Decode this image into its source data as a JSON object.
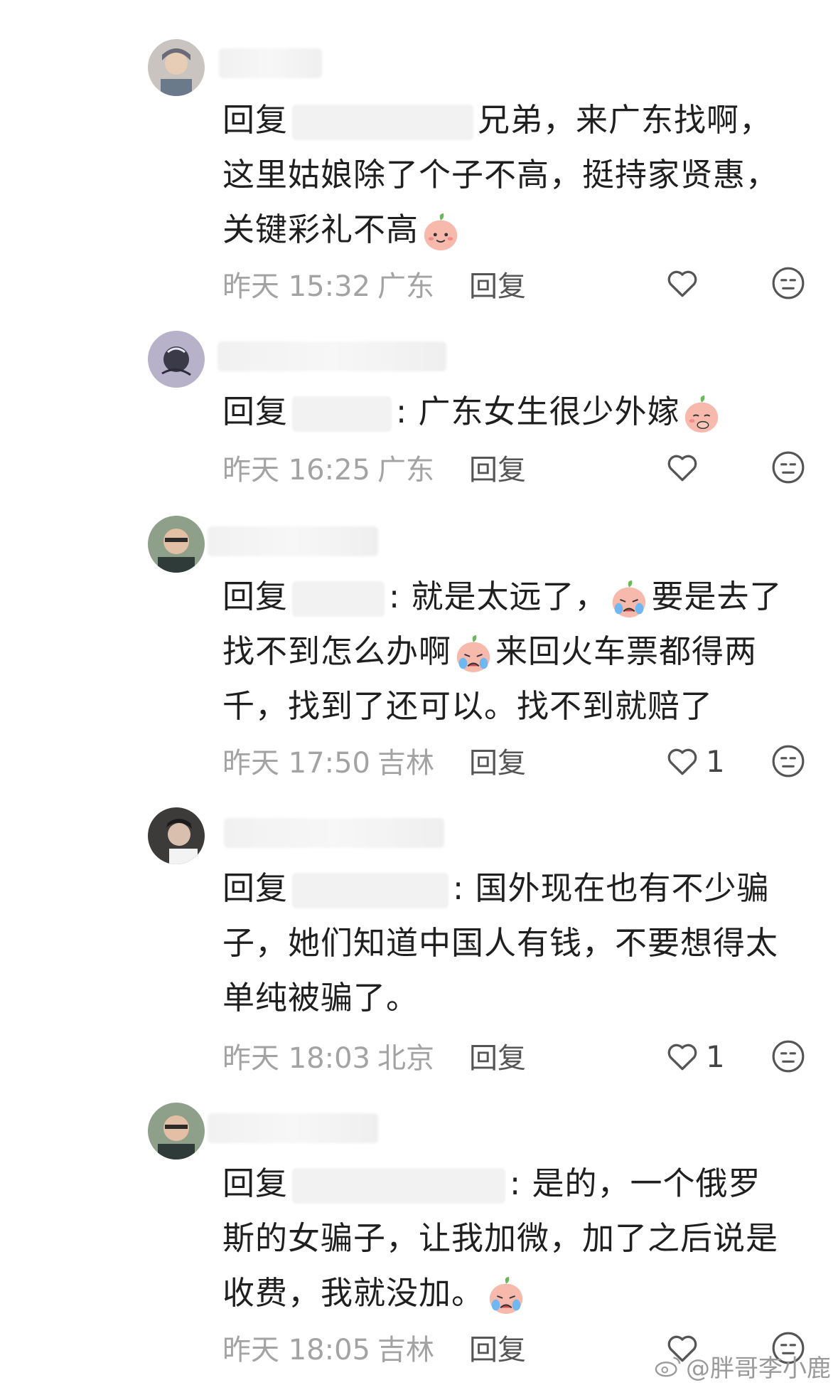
{
  "comments": [
    {
      "reply_prefix": "回复",
      "text_a": "兄弟，来广东找啊，",
      "text_b": "这里姑娘除了个子不高，挺持家贤惠，",
      "text_c": "关键彩礼不高",
      "time": "昨天 15:32",
      "location": "广东",
      "reply_label": "回复",
      "likes": ""
    },
    {
      "reply_prefix": "回复",
      "text_a": ": 广东女生很少外嫁",
      "time": "昨天 16:25",
      "location": "广东",
      "reply_label": "回复",
      "likes": ""
    },
    {
      "reply_prefix": "回复",
      "text_a": ": 就是太远了，",
      "text_b": "要是去了",
      "text_c": "找不到怎么办啊",
      "text_d": "来回火车票都得两",
      "text_e": "千，找到了还可以。找不到就赔了",
      "time": "昨天 17:50",
      "location": "吉林",
      "reply_label": "回复",
      "likes": "1"
    },
    {
      "reply_prefix": "回复",
      "text_a": ": 国外现在也有不少骗",
      "text_b": "子，她们知道中国人有钱，不要想得太",
      "text_c": "单纯被骗了。",
      "time": "昨天 18:03",
      "location": "北京",
      "reply_label": "回复",
      "likes": "1"
    },
    {
      "reply_prefix": "回复",
      "text_a": ": 是的，一个俄罗",
      "text_b": "斯的女骗子，让我加微，加了之后说是",
      "text_c": "收费，我就没加。",
      "time": "昨天 18:05",
      "location": "吉林",
      "reply_label": "回复",
      "likes": ""
    }
  ],
  "watermark": "@胖哥李小鹿",
  "icons": [
    "heart-icon",
    "neutral-face-icon",
    "peach-emoji",
    "weibo-logo-icon"
  ],
  "colors": {
    "meta": "#a3a3a3",
    "text": "#1f1f1f",
    "background": "#ffffff"
  }
}
